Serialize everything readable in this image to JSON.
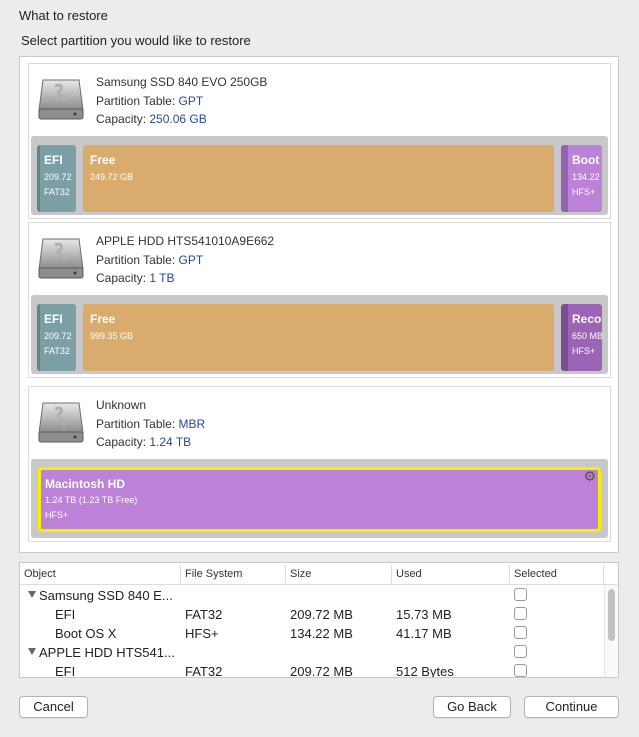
{
  "header": {
    "title": "What to restore",
    "subtitle": "Select partition you would like to restore"
  },
  "disks": [
    {
      "name": "Samsung SSD 840 EVO 250GB",
      "partition_table_label": "Partition Table:",
      "partition_table": "GPT",
      "capacity_label": "Capacity:",
      "capacity": "250.06 GB",
      "partitions": [
        {
          "name": "EFI",
          "size": "209.72",
          "fs": "FAT32"
        },
        {
          "name": "Free",
          "size": "249.72 GB",
          "fs": ""
        },
        {
          "name": "Boot O",
          "size": "134.22",
          "fs": "HFS+"
        }
      ]
    },
    {
      "name": "APPLE HDD HTS541010A9E662",
      "partition_table_label": "Partition Table:",
      "partition_table": "GPT",
      "capacity_label": "Capacity:",
      "capacity": "1 TB",
      "partitions": [
        {
          "name": "EFI",
          "size": "209.72",
          "fs": "FAT32"
        },
        {
          "name": "Free",
          "size": "999.35 GB",
          "fs": ""
        },
        {
          "name": "Recov",
          "size": "650 MB",
          "fs": "HFS+"
        }
      ]
    },
    {
      "name": "Unknown",
      "partition_table_label": "Partition Table:",
      "partition_table": "MBR",
      "capacity_label": "Capacity:",
      "capacity": "1.24 TB",
      "partitions": [
        {
          "name": "Macintosh HD",
          "size": "1.24 TB (1.23 TB Free)",
          "fs": "HFS+",
          "selected": true
        }
      ]
    }
  ],
  "table": {
    "columns": [
      "Object",
      "File System",
      "Size",
      "Used",
      "Selected"
    ],
    "rows": [
      {
        "object": "Samsung SSD 840 E...",
        "fs": "",
        "size": "",
        "used": "",
        "group": true
      },
      {
        "object": "EFI",
        "fs": "FAT32",
        "size": "209.72 MB",
        "used": "15.73 MB",
        "group": false
      },
      {
        "object": "Boot OS X",
        "fs": "HFS+",
        "size": "134.22 MB",
        "used": "41.17 MB",
        "group": false
      },
      {
        "object": "APPLE HDD HTS541...",
        "fs": "",
        "size": "",
        "used": "",
        "group": true
      },
      {
        "object": "EFI",
        "fs": "FAT32",
        "size": "209.72 MB",
        "used": "512 Bytes",
        "group": false
      }
    ]
  },
  "buttons": {
    "cancel": "Cancel",
    "back": "Go Back",
    "continue": "Continue"
  },
  "colors": {
    "efi": "#7b9fa5",
    "free": "#d9ab6d",
    "hfs": "#bb82d8",
    "selection": "#f5f000",
    "link": "#27489a"
  },
  "icons": {
    "disk": "hard-disk-icon",
    "gear": "gear-icon",
    "expand": "disclosure-triangle-icon"
  }
}
